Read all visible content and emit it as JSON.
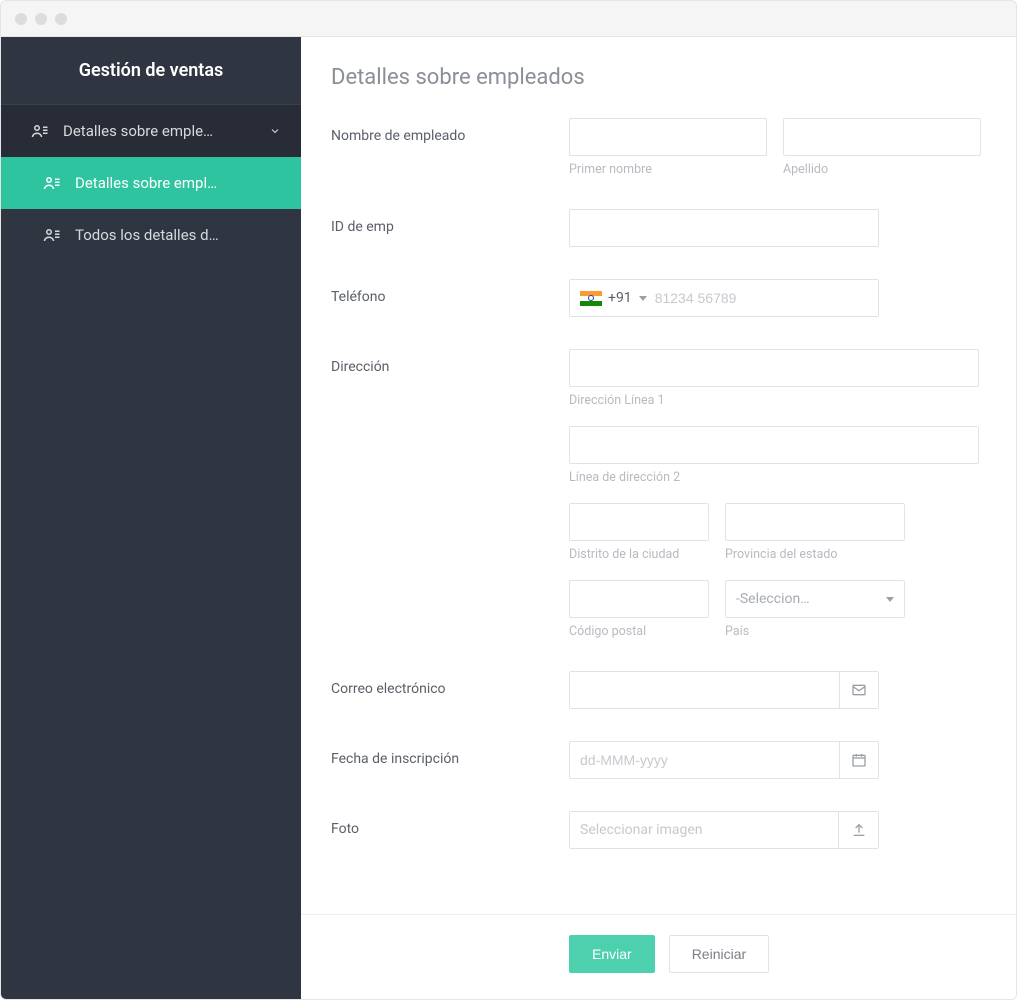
{
  "window": {
    "title": "Gestión de ventas"
  },
  "sidebar": {
    "title": "Gestión de ventas",
    "items": [
      {
        "label": "Detalles sobre emple…"
      },
      {
        "label": "Detalles sobre empl…"
      },
      {
        "label": "Todos los detalles d…"
      }
    ]
  },
  "page": {
    "title": "Detalles sobre empleados"
  },
  "form": {
    "employee_name": {
      "label": "Nombre de empleado",
      "first_sub": "Primer nombre",
      "last_sub": "Apellido"
    },
    "emp_id": {
      "label": "ID de emp"
    },
    "phone": {
      "label": "Teléfono",
      "country_code": "+91",
      "placeholder": "81234 56789"
    },
    "address": {
      "label": "Dirección",
      "line1_sub": "Dirección Línea 1",
      "line2_sub": "Línea de dirección 2",
      "city_sub": "Distrito de la ciudad",
      "state_sub": "Provincia del estado",
      "postal_sub": "Código postal",
      "country_placeholder": "-Seleccion…",
      "country_sub": "País"
    },
    "email": {
      "label": "Correo electrónico"
    },
    "date": {
      "label": "Fecha de inscripción",
      "placeholder": "dd-MMM-yyyy"
    },
    "photo": {
      "label": "Foto",
      "placeholder": "Seleccionar imagen"
    },
    "buttons": {
      "submit": "Enviar",
      "reset": "Reiniciar"
    }
  }
}
